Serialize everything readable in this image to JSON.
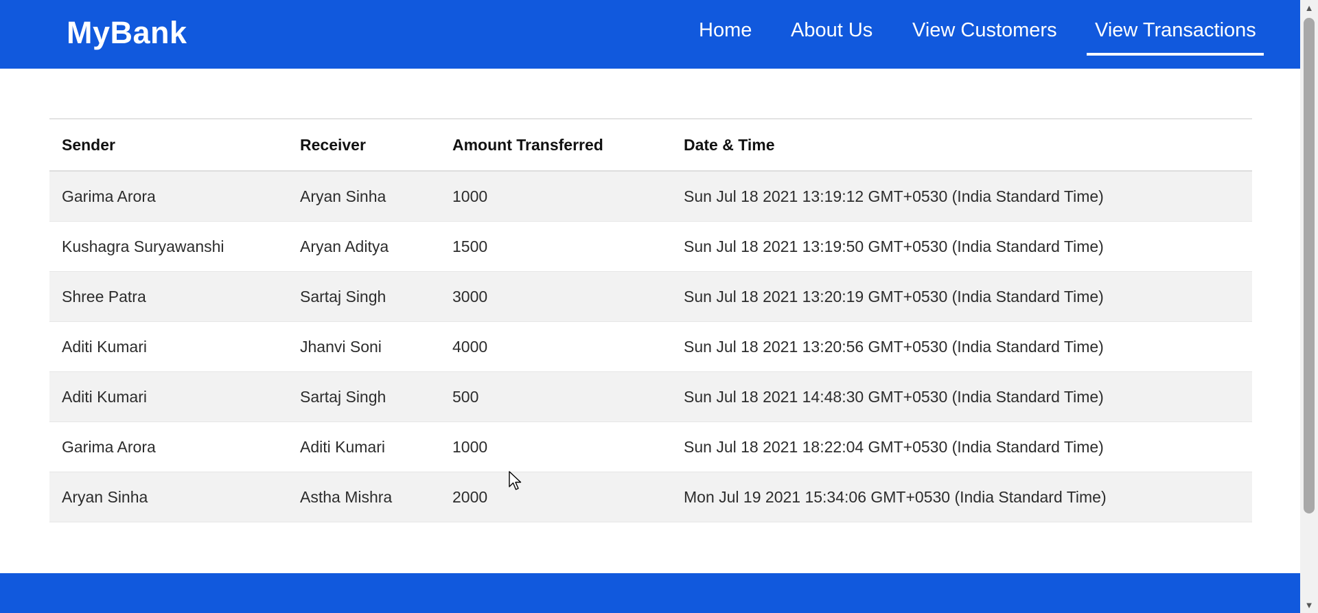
{
  "brand": "MyBank",
  "nav": {
    "home": "Home",
    "about": "About Us",
    "customers": "View Customers",
    "transactions": "View Transactions",
    "active": "View Transactions"
  },
  "table": {
    "headers": [
      "Sender",
      "Receiver",
      "Amount Transferred",
      "Date & Time"
    ],
    "rows": [
      [
        "Garima Arora",
        "Aryan Sinha",
        "1000",
        "Sun Jul 18 2021 13:19:12 GMT+0530 (India Standard Time)"
      ],
      [
        "Kushagra Suryawanshi",
        "Aryan Aditya",
        "1500",
        "Sun Jul 18 2021 13:19:50 GMT+0530 (India Standard Time)"
      ],
      [
        "Shree Patra",
        "Sartaj Singh",
        "3000",
        "Sun Jul 18 2021 13:20:19 GMT+0530 (India Standard Time)"
      ],
      [
        "Aditi Kumari",
        "Jhanvi Soni",
        "4000",
        "Sun Jul 18 2021 13:20:56 GMT+0530 (India Standard Time)"
      ],
      [
        "Aditi Kumari",
        "Sartaj Singh",
        "500",
        "Sun Jul 18 2021 14:48:30 GMT+0530 (India Standard Time)"
      ],
      [
        "Garima Arora",
        "Aditi Kumari",
        "1000",
        "Sun Jul 18 2021 18:22:04 GMT+0530 (India Standard Time)"
      ],
      [
        "Aryan Sinha",
        "Astha Mishra",
        "2000",
        "Mon Jul 19 2021 15:34:06 GMT+0530 (India Standard Time)"
      ]
    ]
  },
  "colors": {
    "brand_blue": "#1159dd",
    "stripe": "#f2f2f2"
  },
  "icons": {
    "scroll_up": "scroll-up-arrow-icon",
    "scroll_down": "scroll-down-arrow-icon",
    "cursor": "mouse-cursor-icon"
  }
}
